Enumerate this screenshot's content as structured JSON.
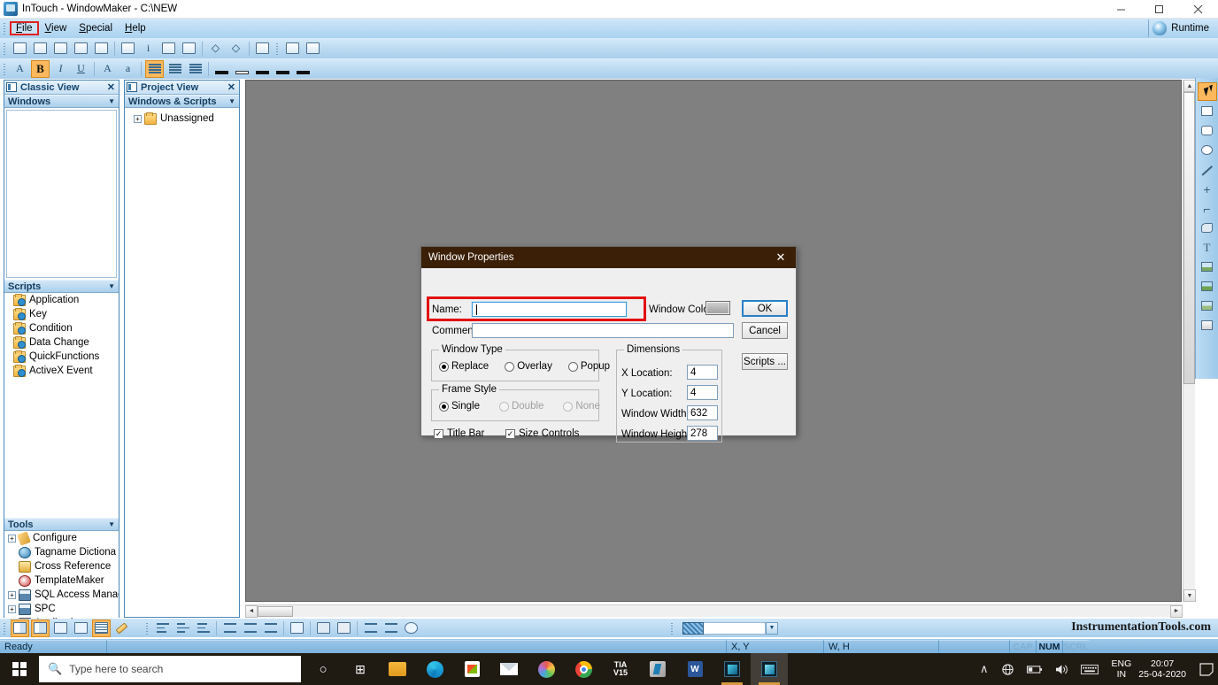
{
  "window": {
    "title": "InTouch - WindowMaker - C:\\NEW",
    "icon": "app-icon",
    "minimize": "minimize-icon",
    "maximize": "maximize-icon",
    "close": "close-icon"
  },
  "menubar": {
    "items": [
      {
        "label": "File",
        "mnemonic": "F",
        "active": true
      },
      {
        "label": "View",
        "mnemonic": "V",
        "active": false
      },
      {
        "label": "Special",
        "mnemonic": "S",
        "active": false
      },
      {
        "label": "Help",
        "mnemonic": "H",
        "active": false
      }
    ],
    "runtime_label": "Runtime"
  },
  "classic_view": {
    "title": "Classic View",
    "close_label": "✕",
    "sections": [
      {
        "name": "Windows",
        "caret": "▼",
        "items": []
      },
      {
        "name": "Scripts",
        "caret": "▼",
        "items": [
          {
            "label": "Application",
            "icon": "folder-script-icon"
          },
          {
            "label": "Key",
            "icon": "folder-script-icon"
          },
          {
            "label": "Condition",
            "icon": "folder-script-icon"
          },
          {
            "label": "Data Change",
            "icon": "folder-script-icon"
          },
          {
            "label": "QuickFunctions",
            "icon": "folder-script-icon"
          },
          {
            "label": "ActiveX Event",
            "icon": "folder-script-icon"
          }
        ]
      },
      {
        "name": "Tools",
        "caret": "▼",
        "items": [
          {
            "label": "Configure",
            "icon": "wrench-icon",
            "expandable": true
          },
          {
            "label": "Tagname Dictiona",
            "icon": "globe-icon",
            "expandable": false
          },
          {
            "label": "Cross Reference",
            "icon": "key-icon",
            "expandable": false
          },
          {
            "label": "TemplateMaker",
            "icon": "template-icon",
            "expandable": false
          },
          {
            "label": "SQL Access Manag",
            "icon": "sql-icon",
            "expandable": true
          },
          {
            "label": "SPC",
            "icon": "sql-icon",
            "expandable": true
          },
          {
            "label": "Applications",
            "icon": "window-icon",
            "expandable": true
          }
        ]
      }
    ]
  },
  "project_view": {
    "title": "Project View",
    "close_label": "✕",
    "section_name": "Windows & Scripts",
    "caret": "▼",
    "items": [
      {
        "label": "Unassigned",
        "icon": "folder-icon",
        "expandable": true
      }
    ]
  },
  "dialog": {
    "title": "Window Properties",
    "close_label": "✕",
    "name_label": "Name:",
    "name_value": "",
    "comment_label": "Comment:",
    "comment_value": "",
    "window_color_label": "Window Color:",
    "window_color_value": "#9e9e9e",
    "buttons": {
      "ok": "OK",
      "cancel": "Cancel",
      "scripts": "Scripts ..."
    },
    "window_type": {
      "legend": "Window Type",
      "options": [
        {
          "label": "Replace",
          "selected": true,
          "disabled": false
        },
        {
          "label": "Overlay",
          "selected": false,
          "disabled": false
        },
        {
          "label": "Popup",
          "selected": false,
          "disabled": false
        }
      ]
    },
    "frame_style": {
      "legend": "Frame Style",
      "options": [
        {
          "label": "Single",
          "selected": true,
          "disabled": false
        },
        {
          "label": "Double",
          "selected": false,
          "disabled": true
        },
        {
          "label": "None",
          "selected": false,
          "disabled": true
        }
      ]
    },
    "checkboxes": [
      {
        "label": "Title Bar",
        "checked": true,
        "mark": "✓"
      },
      {
        "label": "Size Controls",
        "checked": true,
        "mark": "✓"
      }
    ],
    "dimensions": {
      "legend": "Dimensions",
      "fields": [
        {
          "label": "X Location:",
          "value": "4"
        },
        {
          "label": "Y Location:",
          "value": "4"
        },
        {
          "label": "Window Width:",
          "value": "632"
        },
        {
          "label": "Window Height:",
          "value": "278"
        }
      ]
    }
  },
  "statusbar": {
    "ready_text": "Ready",
    "xy_label": "X, Y",
    "wh_label": "W, H",
    "indicators": [
      {
        "label": "CAP",
        "on": false
      },
      {
        "label": "NUM",
        "on": true
      },
      {
        "label": "SCRL",
        "on": false
      }
    ]
  },
  "watermark": "InstrumentationTools.com",
  "taskbar": {
    "start_icon": "windows-logo-icon",
    "search_placeholder": "Type here to search",
    "search_icon": "search-icon",
    "apps": [
      {
        "name": "cortana-icon",
        "glyph": "○"
      },
      {
        "name": "task-view-icon",
        "glyph": "⧉"
      },
      {
        "name": "file-explorer-icon",
        "glyph": ""
      },
      {
        "name": "edge-icon",
        "glyph": ""
      },
      {
        "name": "microsoft-store-icon",
        "glyph": ""
      },
      {
        "name": "mail-icon",
        "glyph": ""
      },
      {
        "name": "paint-icon",
        "glyph": ""
      },
      {
        "name": "chrome-icon",
        "glyph": ""
      },
      {
        "name": "tia-portal-v15-icon",
        "glyph": "TIA"
      },
      {
        "name": "app-icon-grey",
        "glyph": ""
      },
      {
        "name": "word-icon",
        "glyph": "W"
      },
      {
        "name": "intouch-window-viewer-icon",
        "glyph": ""
      },
      {
        "name": "intouch-windowmaker-icon",
        "glyph": ""
      }
    ],
    "tray": {
      "chevron": "∧",
      "network_icon": "network-offline-icon",
      "battery_icon": "battery-icon",
      "volume_icon": "volume-icon",
      "keyboard_icon": "keyboard-icon",
      "language_top": "ENG",
      "language_bottom": "IN",
      "time": "20:07",
      "date": "25-04-2020",
      "action_center_icon": "action-center-icon"
    }
  },
  "toolbar_row1": [
    "new-window-icon",
    "open-window-icon",
    "save-window-icon",
    "save-all-icon",
    "window-properties-icon",
    "sep",
    "duplicate-icon",
    "info-icon",
    "undo-icon",
    "redo-icon",
    "sep",
    "arrange-left-icon",
    "arrange-right-icon",
    "sep",
    "print-icon",
    "sep",
    "runtime-icon",
    "switch-icon"
  ],
  "toolbar_row2": [
    "font-icon",
    "bold-icon",
    "italic-icon",
    "underline-icon",
    "sep",
    "grow-font-icon",
    "shrink-font-icon",
    "sep",
    "align-left-icon",
    "align-center-icon",
    "align-right-icon",
    "sep",
    "line-color-icon",
    "fill-color-icon",
    "text-color-icon",
    "window-color-icon",
    "blink-color-icon"
  ],
  "bottom_tools_left": [
    "classic-view-icon",
    "project-view-icon",
    "window-icon",
    "grid-select-icon",
    "sep",
    "show-grid-icon",
    "ruler-icon"
  ],
  "bottom_tools_right": [
    "align-top-icon",
    "align-middle-icon",
    "align-bottom-icon",
    "sep",
    "space-across-icon",
    "space-down-icon",
    "space-even-icon",
    "sep",
    "center-icon",
    "sep",
    "bring-front-icon",
    "send-back-icon",
    "sep",
    "flip-horizontal-icon",
    "flip-vertical-icon",
    "rotate-icon"
  ],
  "right_palette": [
    {
      "name": "select-tool",
      "selected": true
    },
    {
      "name": "rectangle-tool",
      "selected": false
    },
    {
      "name": "rounded-rectangle-tool",
      "selected": false
    },
    {
      "name": "ellipse-tool",
      "selected": false
    },
    {
      "name": "line-tool",
      "selected": false
    },
    {
      "name": "h-v-line-tool",
      "selected": false
    },
    {
      "name": "polyline-tool",
      "selected": false
    },
    {
      "name": "polygon-tool",
      "selected": false
    },
    {
      "name": "text-tool",
      "selected": false
    },
    {
      "name": "bitmap-tool",
      "selected": false
    },
    {
      "name": "wizard-tool",
      "selected": false
    },
    {
      "name": "symbol-tool",
      "selected": false
    },
    {
      "name": "button-tool",
      "selected": false
    }
  ]
}
